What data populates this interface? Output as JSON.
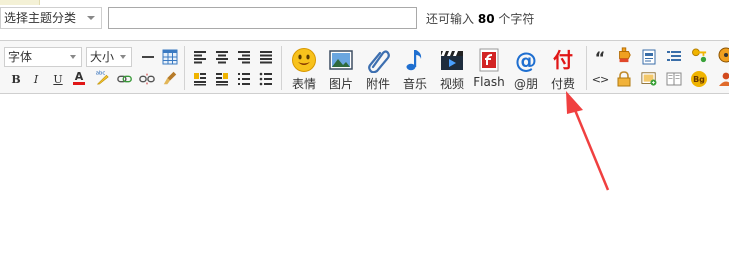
{
  "category_select": {
    "value": "选择主题分类"
  },
  "subject": {
    "value": ""
  },
  "remaining": {
    "prefix": "还可输入",
    "count": "80",
    "suffix": "个字符"
  },
  "toolbar": {
    "font_family": "字体",
    "font_size": "大小",
    "bold": "B",
    "italic": "I",
    "underline": "U",
    "font_color": "A",
    "big_buttons": [
      {
        "label": "表情"
      },
      {
        "label": "图片"
      },
      {
        "label": "附件"
      },
      {
        "label": "音乐"
      },
      {
        "label": "视频"
      },
      {
        "label": "Flash"
      },
      {
        "label": "@朋"
      },
      {
        "label": "付费",
        "glyph": "付"
      }
    ],
    "quote_glyph": "“",
    "code_glyph": "<>",
    "bg_label": "Bg"
  },
  "colors": {
    "accent_red": "#e01616",
    "arrow_red": "#f04040"
  }
}
